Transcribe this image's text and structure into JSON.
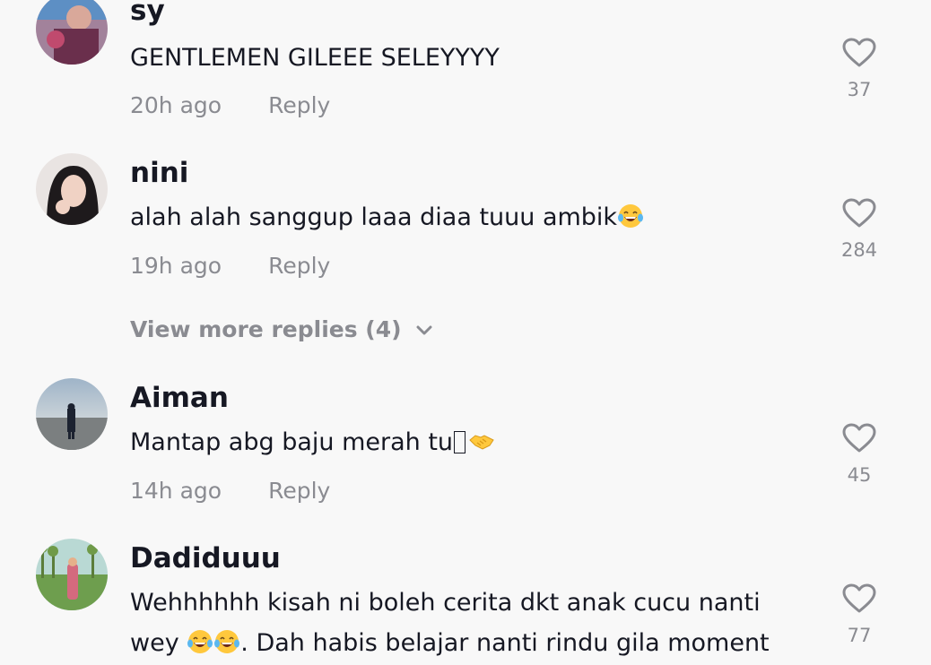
{
  "comments": [
    {
      "username": "sy",
      "text": "GENTLEMEN GILEEE SELEYYYY",
      "time": "20h ago",
      "reply_label": "Reply",
      "likes": "37"
    },
    {
      "username": "nini",
      "text": "alah alah sanggup laaa diaa tuuu ambik",
      "text_emoji": "face-with-tears-of-joy",
      "time": "19h ago",
      "reply_label": "Reply",
      "likes": "284"
    },
    {
      "username": "Aiman",
      "text": "Mantap abg baju merah tu",
      "text_emoji": "handshake",
      "time": "14h ago",
      "reply_label": "Reply",
      "likes": "45"
    },
    {
      "username": "Dadiduuu",
      "text_line1": "Wehhhhhh kisah ni boleh cerita dkt anak cucu nanti",
      "text_line2_pre": "wey",
      "text_line2_post": ". Dah habis belajar nanti rindu gila moment",
      "text_emoji": "face-with-tears-of-joy",
      "likes": "77"
    }
  ],
  "view_more": {
    "label": "View more replies (4)",
    "icon": "chevron-down-icon"
  },
  "colors": {
    "background": "#f8f8f8",
    "primary_text": "#161823",
    "secondary_text": "#8a8b91",
    "emoji_yellow": "#ffc83d"
  }
}
